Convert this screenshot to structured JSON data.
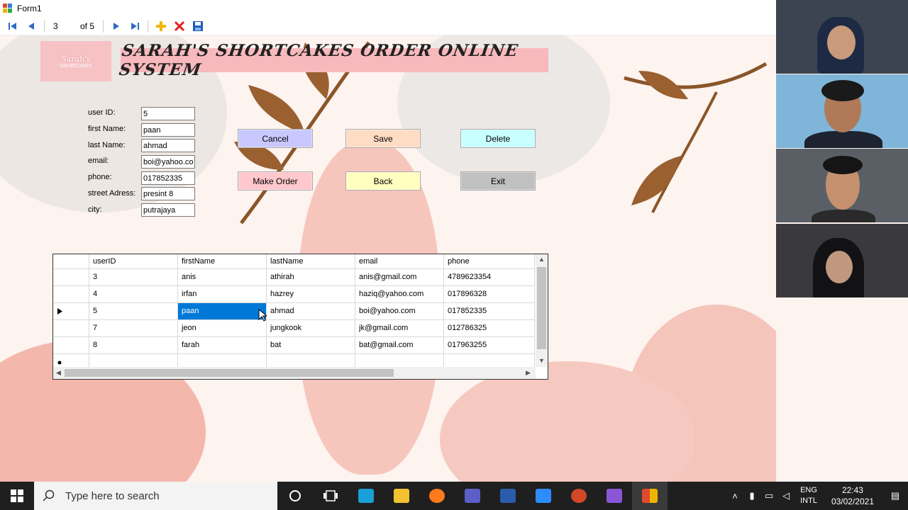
{
  "window": {
    "title": "Form1"
  },
  "navigator": {
    "position": "3",
    "count": "of 5"
  },
  "header": {
    "logo_text": "Sarah's",
    "logo_sub": "SHORTCAKES",
    "banner": "SARAH'S SHORTCAKES ORDER ONLINE SYSTEM"
  },
  "form": {
    "fields": [
      {
        "label": "user ID:",
        "value": "5"
      },
      {
        "label": "first Name:",
        "value": "paan"
      },
      {
        "label": "last Name:",
        "value": "ahmad"
      },
      {
        "label": "email:",
        "value": "boi@yahoo.com"
      },
      {
        "label": "phone:",
        "value": "017852335"
      },
      {
        "label": "street Adress:",
        "value": "presint 8"
      },
      {
        "label": "city:",
        "value": "putrajaya"
      }
    ]
  },
  "buttons": {
    "cancel": "Cancel",
    "save": "Save",
    "delete": "Delete",
    "make_order": "Make Order",
    "back": "Back",
    "exit": "Exit"
  },
  "button_colors": {
    "cancel": "#c8c8ff",
    "save": "#ffdcc4",
    "delete": "#c8ffff",
    "make_order": "#ffc8cc",
    "back": "#ffffc0",
    "exit": "#c0c0c0"
  },
  "grid": {
    "columns": [
      "userID",
      "firstName",
      "lastName",
      "email",
      "phone"
    ],
    "rows": [
      [
        "3",
        "anis",
        "athirah",
        "anis@gmail.com",
        "4789623354"
      ],
      [
        "4",
        "irfan",
        "hazrey",
        "haziq@yahoo.com",
        "017896328"
      ],
      [
        "5",
        "paan",
        "ahmad",
        "boi@yahoo.com",
        "017852335"
      ],
      [
        "7",
        "jeon",
        "jungkook",
        "jk@gmail.com",
        "012786325"
      ],
      [
        "8",
        "farah",
        "bat",
        "bat@gmail.com",
        "017963255"
      ]
    ],
    "current_row_index": 2,
    "selected_cell": "paan"
  },
  "taskbar": {
    "search_placeholder": "Type here to search",
    "lang_top": "ENG",
    "lang_bottom": "INTL",
    "time": "22:43",
    "date": "03/02/2021"
  },
  "colors": {
    "accent": "#0078d7",
    "taskbar": "#1f1f1f",
    "banner": "#f8b9bd"
  }
}
